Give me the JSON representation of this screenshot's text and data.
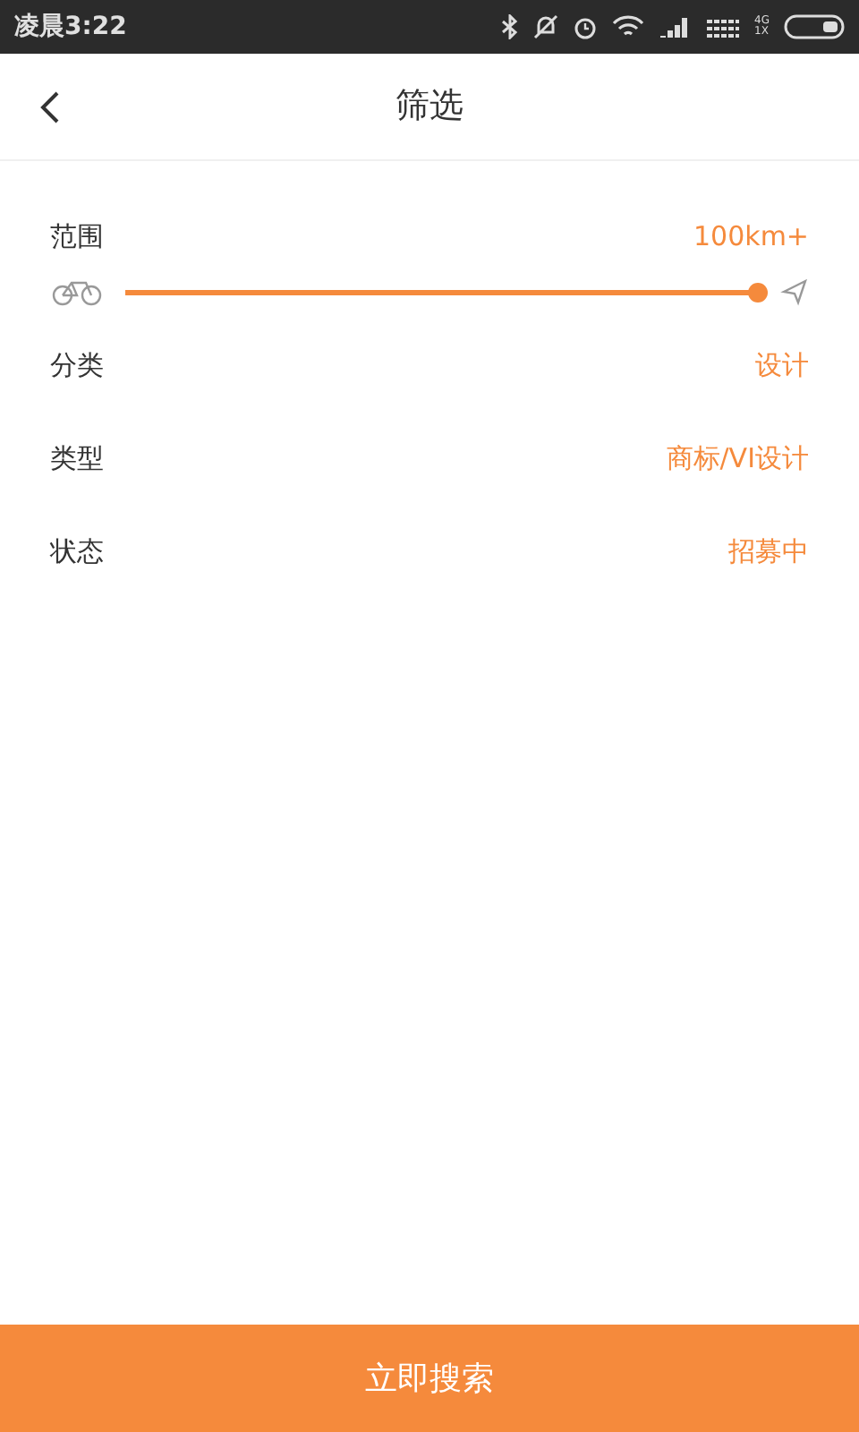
{
  "status_bar": {
    "time": "凌晨3:22",
    "network": "4G 1X"
  },
  "header": {
    "title": "筛选"
  },
  "range": {
    "label": "范围",
    "value": "100km+",
    "level": 1
  },
  "filters": [
    {
      "label": "分类",
      "value": "设计"
    },
    {
      "label": "类型",
      "value": "商标/VI设计"
    },
    {
      "label": "状态",
      "value": "招募中"
    }
  ],
  "search_button": "立即搜索"
}
